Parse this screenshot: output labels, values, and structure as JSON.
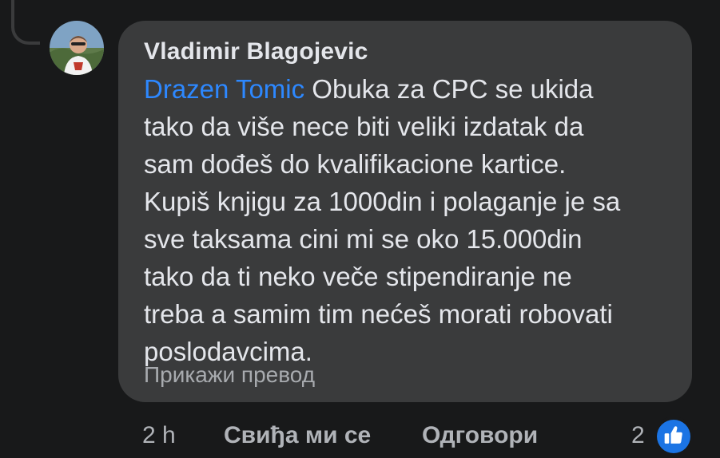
{
  "comment": {
    "author": "Vladimir Blagojevic",
    "mention": "Drazen Tomic",
    "text": " Obuka za CPC se ukida\ntako da više nece biti veliki izdatak da\nsam dođeš do kvalifikacione kartice.\nKupiš knjigu za 1000din i polaganje je sa\nsve taksama cini mi se oko 15.000din\ntako da ti neko veče stipendiranje ne\ntreba a samim tim nećeš morati robovati\nposlodavcima.",
    "translate_label": "Прикажи превод"
  },
  "footer": {
    "time": "2 h",
    "like_label": "Свиђа ми се",
    "reply_label": "Одговори",
    "reaction_count": "2",
    "reaction_icon": "thumbs-up-icon"
  },
  "colors": {
    "background": "#18191a",
    "bubble": "#3a3b3c",
    "mention": "#2d88ff",
    "like_badge": "#1b74e4"
  }
}
